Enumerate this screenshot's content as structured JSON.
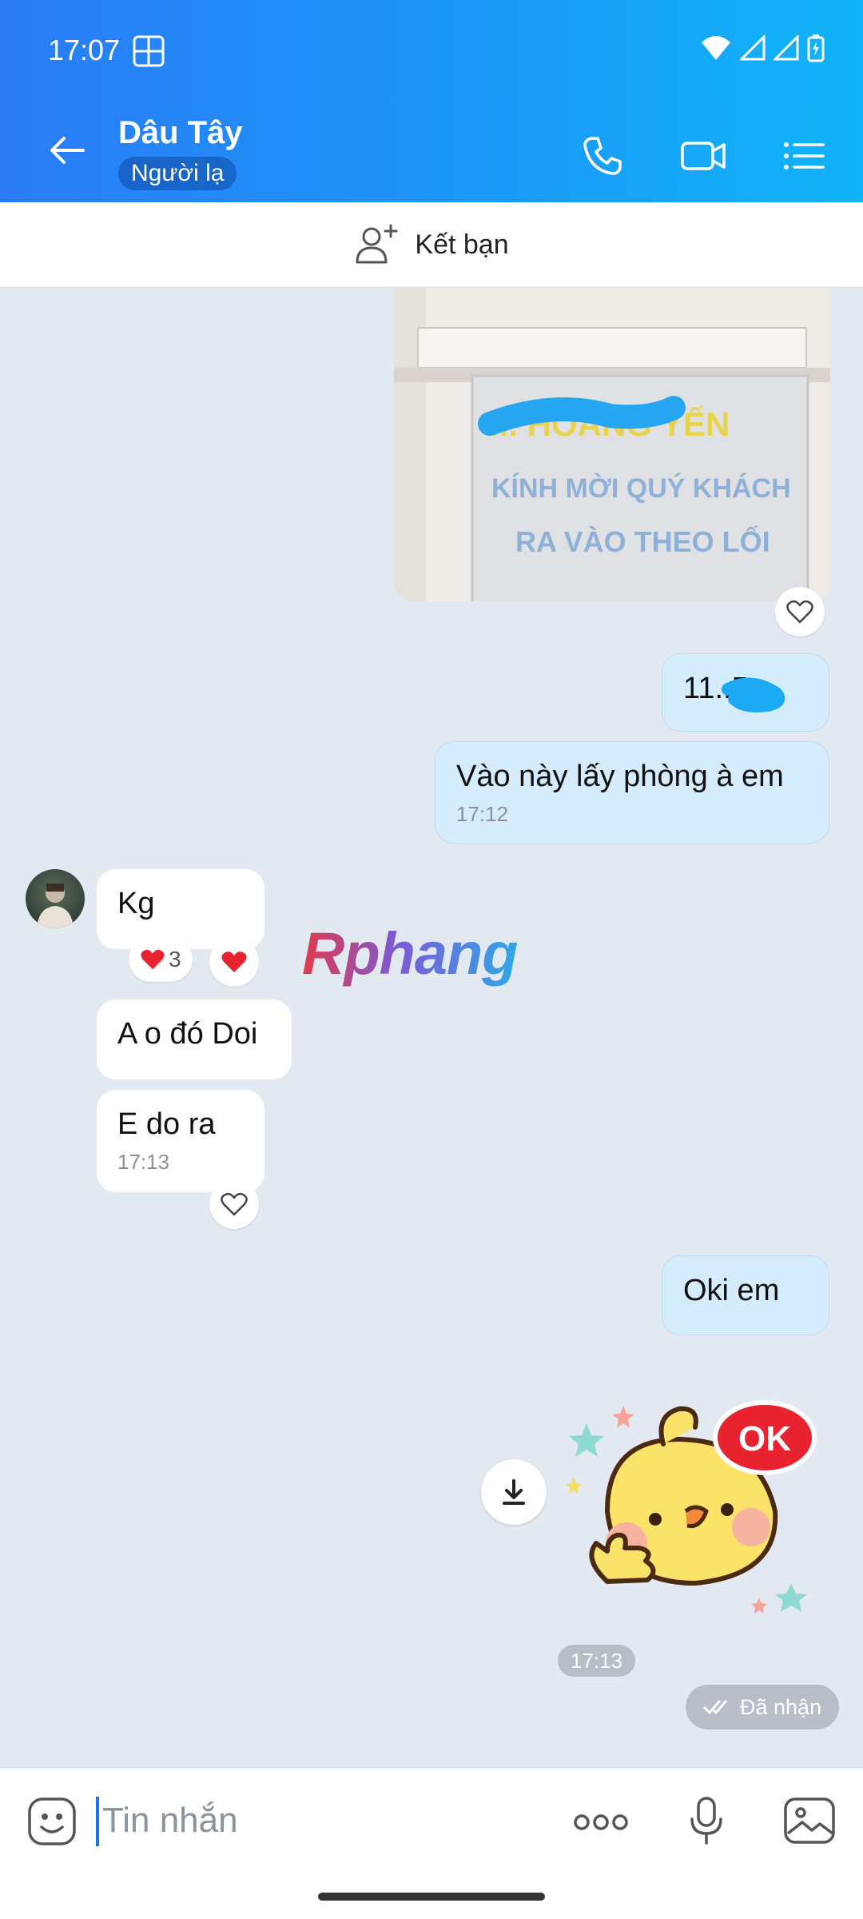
{
  "status": {
    "time": "17:07"
  },
  "header": {
    "title": "Dâu Tây",
    "subtitle": "Người lạ"
  },
  "add_friend": {
    "label": "Kết bạn"
  },
  "photo": {
    "sign_line1": "KÍNH MỜI QUÝ KHÁCH",
    "sign_line2": "RA VÀO THEO LỐI",
    "sign_top": "... HOÀNG YẾN"
  },
  "messages": {
    "m1": {
      "text": "11..5"
    },
    "m2": {
      "text": "Vào này lấy phòng à em",
      "time": "17:12"
    },
    "m3": {
      "text": "Kg",
      "reaction_count": "3"
    },
    "m4": {
      "text": "A o đó Doi"
    },
    "m5": {
      "text": "E do ra",
      "time": "17:13"
    },
    "m6": {
      "text": "Oki em"
    },
    "sticker_text": "OK"
  },
  "sticker_time": "17:13",
  "received_label": "Đã nhận",
  "watermark": "Rphang",
  "input": {
    "placeholder": "Tin nhắn"
  },
  "colors": {
    "header_start": "#2a7bf5",
    "header_end": "#10b4f8",
    "my_bubble": "#d5ecfc",
    "chat_bg": "#e2e9f1"
  }
}
